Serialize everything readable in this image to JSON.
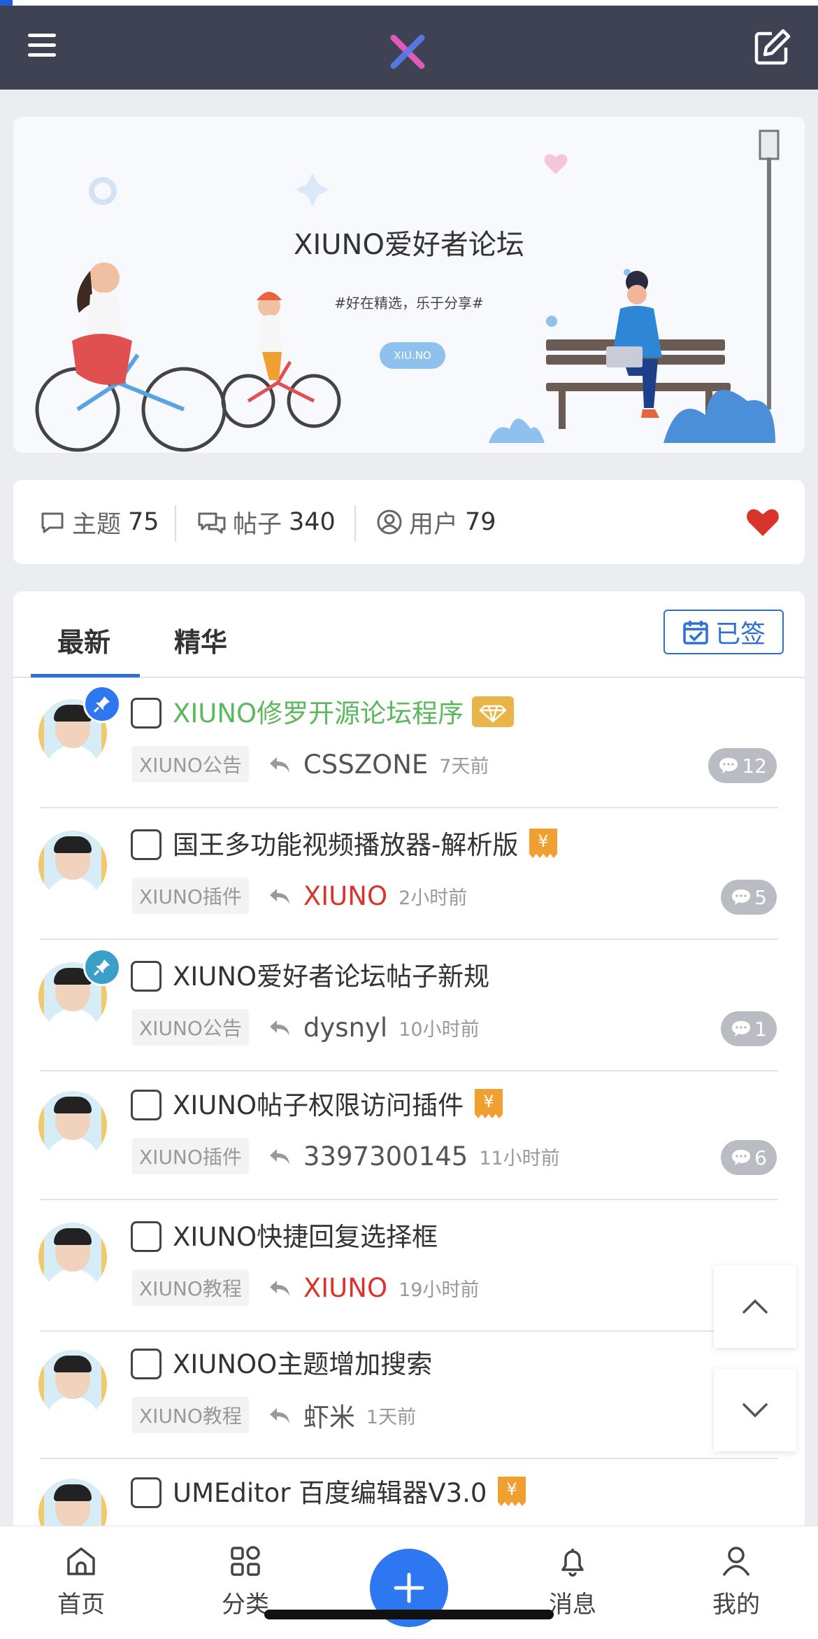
{
  "header": {
    "menu_icon": "hamburger-icon",
    "logo_icon": "x-logo-icon",
    "edit_icon": "edit-icon"
  },
  "banner": {
    "title": "XIUNO爱好者论坛",
    "subtitle": "#好在精选，乐于分享#",
    "pill": "XIU.NO"
  },
  "stats": {
    "topics_label": "主题",
    "topics_count": "75",
    "posts_label": "帖子",
    "posts_count": "340",
    "users_label": "用户",
    "users_count": "79",
    "favorite_icon": "heart-icon"
  },
  "tabs": {
    "latest": "最新",
    "featured": "精华",
    "signed": "已签"
  },
  "threads": [
    {
      "title": "XIUNO修罗开源论坛程序",
      "category": "XIUNO公告",
      "author": "CSSZONE",
      "time": "7天前",
      "comments": "12",
      "pinned": true,
      "pin_color": "#2d77f1",
      "badge": "diamond",
      "title_color": "green",
      "author_color": "normal"
    },
    {
      "title": "国王多功能视频播放器-解析版",
      "category": "XIUNO插件",
      "author": "XIUNO",
      "time": "2小时前",
      "comments": "5",
      "pinned": false,
      "badge": "yen",
      "title_color": "normal",
      "author_color": "red"
    },
    {
      "title": "XIUNO爱好者论坛帖子新规",
      "category": "XIUNO公告",
      "author": "dysnyl",
      "time": "10小时前",
      "comments": "1",
      "pinned": true,
      "pin_color": "#3ba0c8",
      "badge": "",
      "title_color": "normal",
      "author_color": "normal"
    },
    {
      "title": "XIUNO帖子权限访问插件",
      "category": "XIUNO插件",
      "author": "3397300145",
      "time": "11小时前",
      "comments": "6",
      "pinned": false,
      "badge": "yen",
      "title_color": "normal",
      "author_color": "normal"
    },
    {
      "title": "XIUNO快捷回复选择框",
      "category": "XIUNO教程",
      "author": "XIUNO",
      "time": "19小时前",
      "comments": "",
      "pinned": false,
      "badge": "",
      "title_color": "normal",
      "author_color": "red"
    },
    {
      "title": "XIUNOO主题增加搜索",
      "category": "XIUNO教程",
      "author": "虾米",
      "time": "1天前",
      "comments": "",
      "pinned": false,
      "badge": "",
      "title_color": "normal",
      "author_color": "normal"
    },
    {
      "title": "UMEditor 百度编辑器V3.0",
      "category": "",
      "author": "",
      "time": "",
      "comments": "",
      "pinned": false,
      "badge": "yen",
      "title_color": "normal",
      "author_color": "normal"
    }
  ],
  "nav": {
    "home": "首页",
    "categories": "分类",
    "messages": "消息",
    "mine": "我的"
  },
  "colors": {
    "accent": "#2d77f1",
    "topbar": "#3f4253",
    "heart": "#d9342b",
    "badge_orange": "#f0a030"
  }
}
